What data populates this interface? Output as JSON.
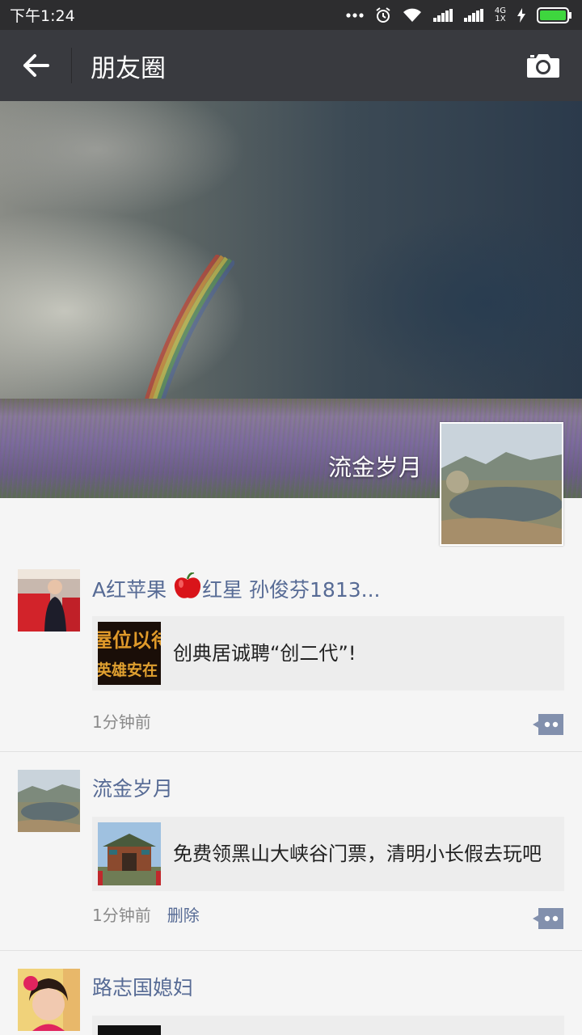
{
  "status_bar": {
    "time": "下午1:24",
    "net_top": "4G",
    "net_bottom": "1X",
    "icons": [
      "more-dots-icon",
      "alarm-icon",
      "wifi-icon",
      "signal-icon",
      "signal-icon",
      "charging-icon",
      "battery-icon"
    ],
    "battery_level": 1.0
  },
  "nav": {
    "title": "朋友圈",
    "back_icon": "arrow-left-icon",
    "camera_icon": "camera-icon"
  },
  "cover": {
    "user_name": "流金岁月"
  },
  "posts": [
    {
      "name_prefix": "A红苹果 ",
      "name_emoji": "apple-emoji",
      "name_suffix": "红星 孙俊芬1813...",
      "link_title": "创典居诚聘“创二代”!",
      "thumb_text_top": "屋位以待",
      "thumb_text_bottom": "英雄安在",
      "time": "1分钟前"
    },
    {
      "name": "流金岁月",
      "link_title": "免费领黑山大峡谷门票，清明小长假去玩吧",
      "time": "1分钟前",
      "delete_label": "删除"
    },
    {
      "name": "路志国媳妇"
    }
  ],
  "colors": {
    "nav_bg": "#393a3f",
    "status_bg": "#2d2d2f",
    "name_link": "#576b95",
    "card_bg": "#ededed"
  }
}
